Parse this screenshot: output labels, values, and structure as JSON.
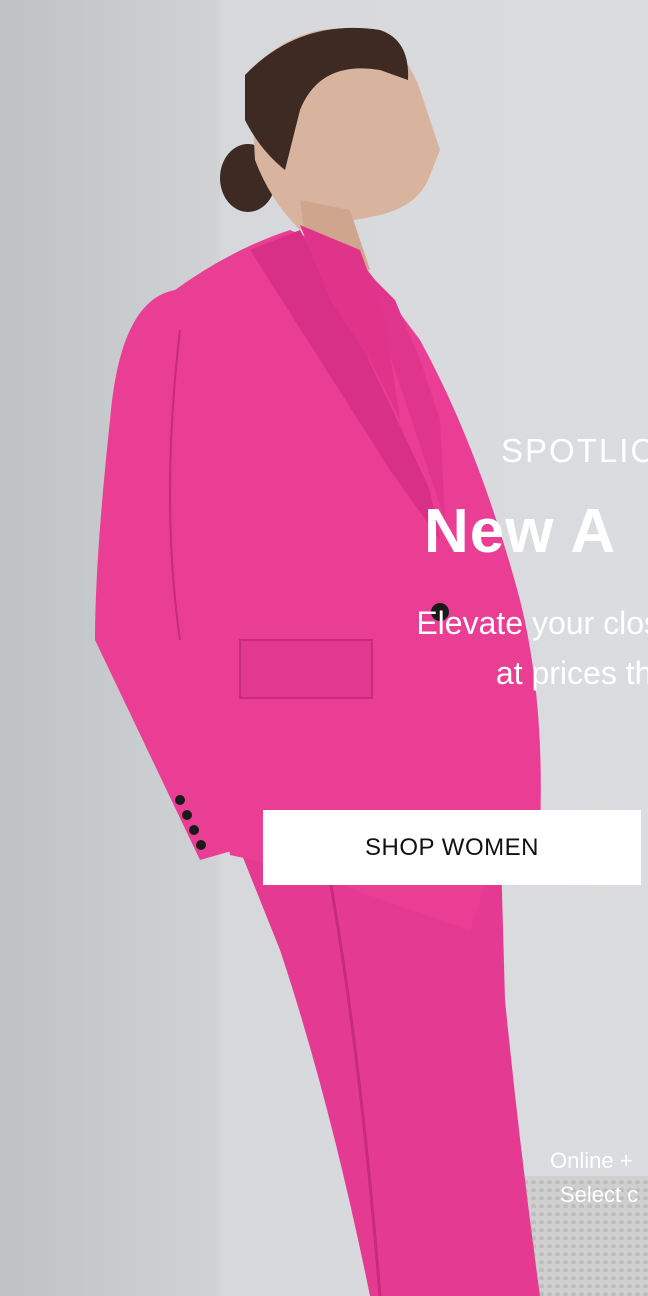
{
  "hero": {
    "eyebrow": "SPOTLIC",
    "headline": "New A",
    "description_line1": "Elevate your closet w",
    "description_line2": "at prices that",
    "cta_label": "SHOP WOMEN",
    "fine_line1": "Online +",
    "fine_line2": "Select c"
  },
  "colors": {
    "suit": "#e5378f",
    "text": "#ffffff",
    "button_bg": "#ffffff",
    "button_text": "#111111"
  }
}
